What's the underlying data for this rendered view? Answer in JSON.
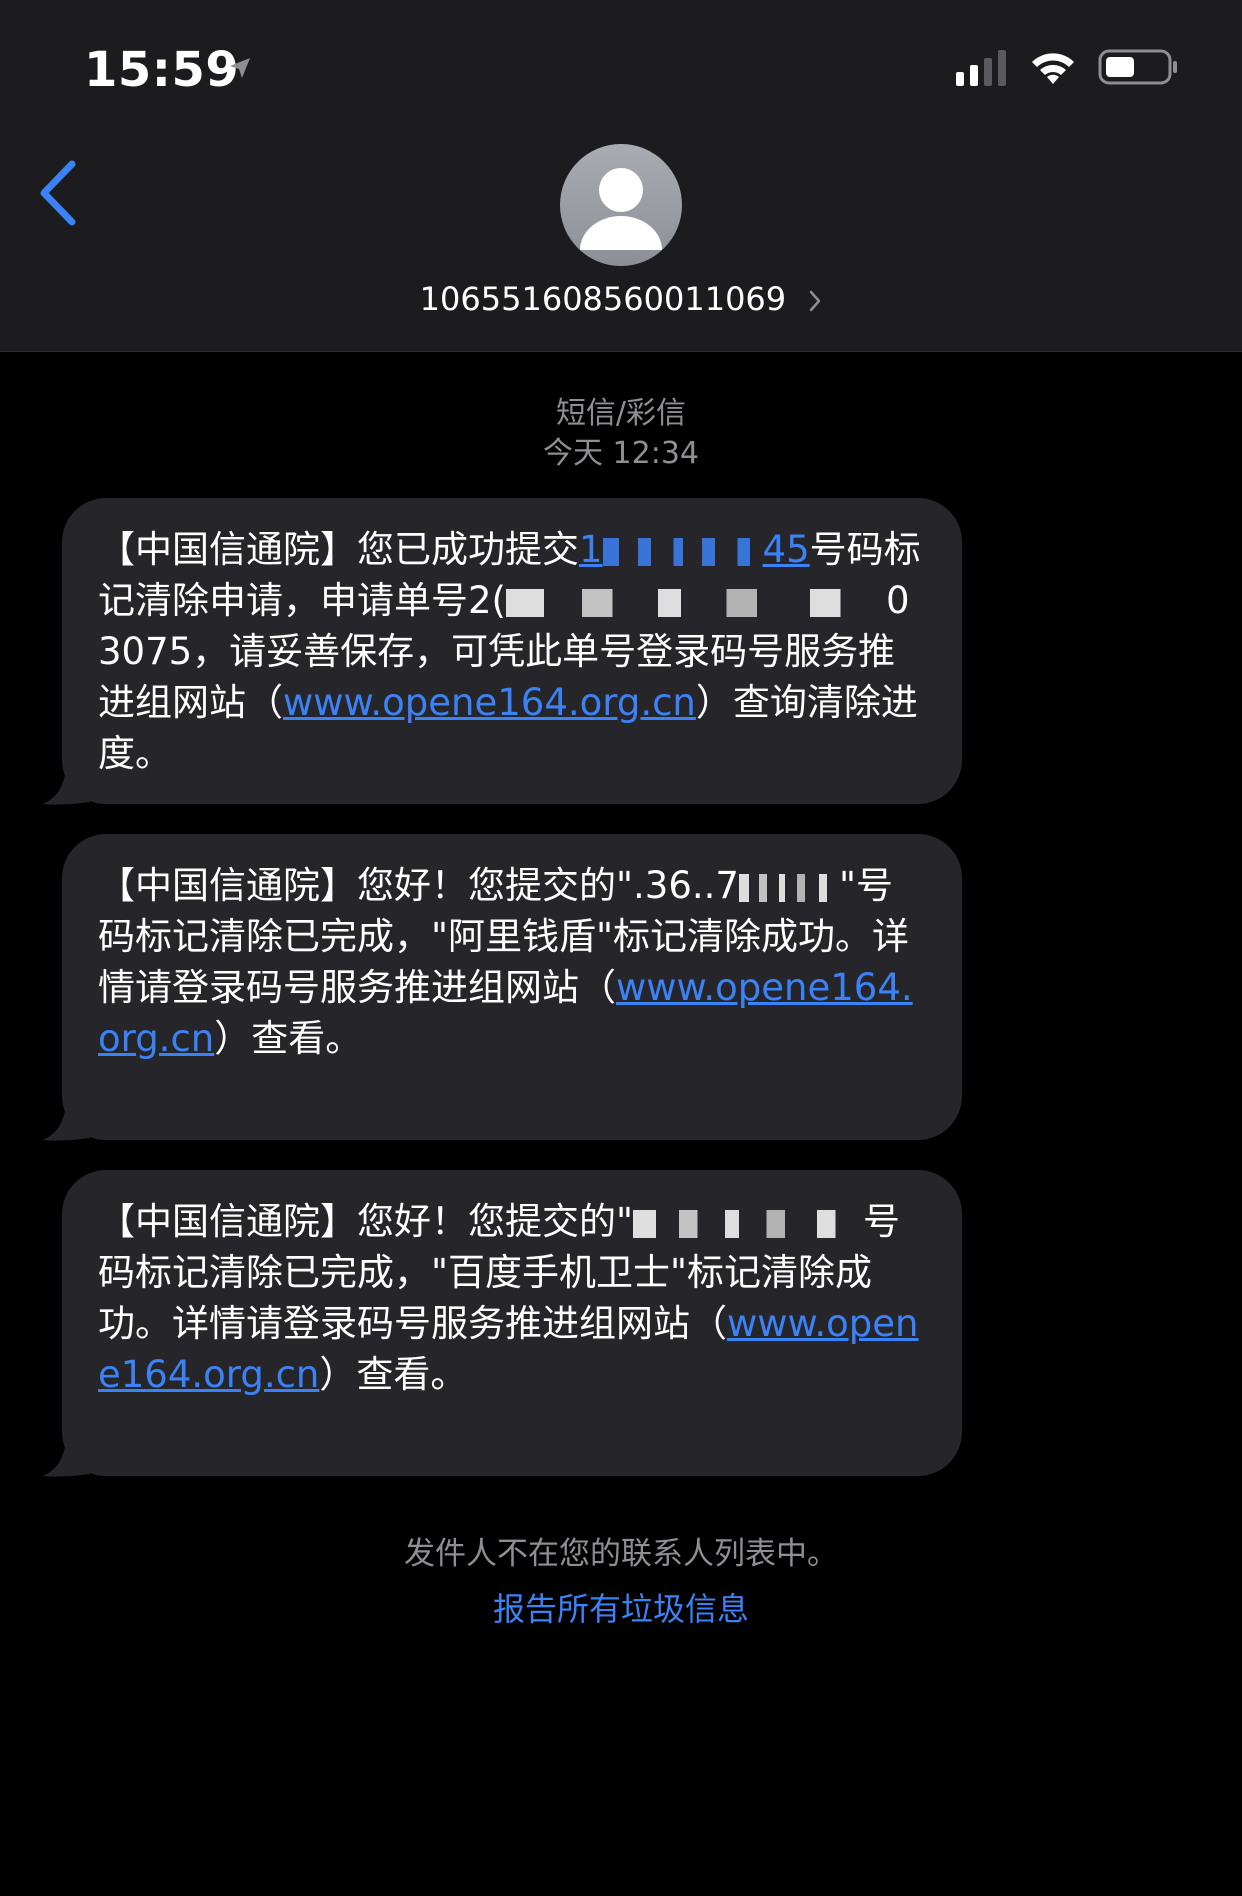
{
  "status_bar": {
    "time": "15:59"
  },
  "header": {
    "contact_number": "106551608560011069"
  },
  "thread_meta": {
    "channel": "短信/彩信",
    "timestamp": "今天 12:34"
  },
  "messages": [
    {
      "part1": "【中国信通院】您已成功提交",
      "number_start": "1",
      "number_end": "45",
      "part2": "号码标记清除申请，申请单号",
      "order_start": "2(",
      "order_end": "03075",
      "part3": "，请妥善保存，可凭此单号登录码号服务推进组网站（",
      "link": "www.opene164.org.cn",
      "part4": "）查询清除进度。"
    },
    {
      "part1": "【中国信通院】您好！您提交的\"",
      "number_partial": ".36..7",
      "part2": "\"号码标记清除已完成，\"阿里钱盾\"标记清除成功。详情请登录码号服务推进组网站（",
      "link": "www.opene164.org.cn",
      "part3": "）查看。"
    },
    {
      "part1": "【中国信通院】您好！您提交的\"",
      "part2": "号码标记清除已完成，\"百度手机卫士\"标记清除成功。详情请登录码号服务推进组网站（",
      "link": "www.opene164.org.cn",
      "part3": "）查看。"
    }
  ],
  "footer": {
    "note": "发件人不在您的联系人列表中。",
    "report_link": "报告所有垃圾信息"
  }
}
